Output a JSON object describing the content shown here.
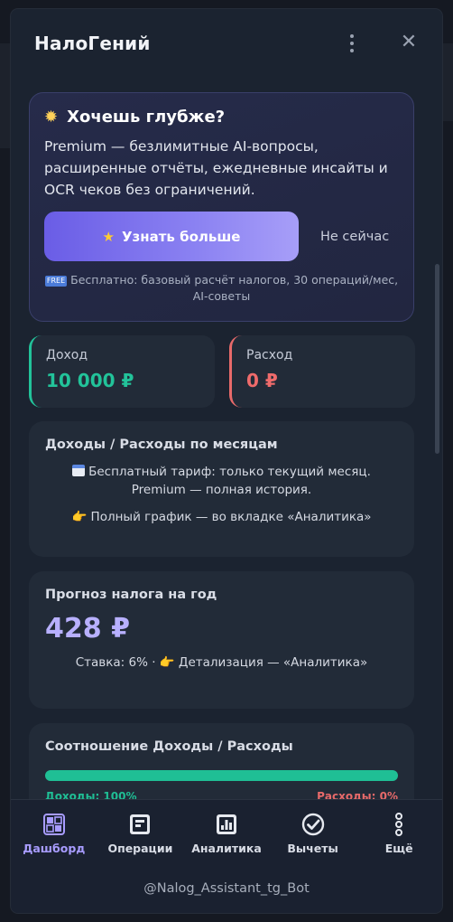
{
  "app": {
    "title": "НалоГений"
  },
  "promo": {
    "title": "Хочешь глубже?",
    "description": "Premium — безлимитные AI-вопросы, расширенные отчёты, ежедневные инсайты и OCR чеков без ограничений.",
    "cta_label": "Узнать больше",
    "later_label": "Не сейчас",
    "free_badge": "FREE",
    "free_note": "Бесплатно: базовый расчёт налогов, 30 операций/мес, AI-советы"
  },
  "stats": {
    "income": {
      "label": "Доход",
      "value": "10 000 ₽"
    },
    "expense": {
      "label": "Расход",
      "value": "0 ₽"
    }
  },
  "monthly": {
    "title": "Доходы / Расходы по месяцам",
    "note1": "Бесплатный тариф: только текущий месяц. Premium — полная история.",
    "note2": "👉 Полный график — во вкладке «Аналитика»"
  },
  "forecast": {
    "title": "Прогноз налога на год",
    "value": "428 ₽",
    "note": "Ставка: 6% · 👉 Детализация — «Аналитика»"
  },
  "ratio": {
    "title": "Соотношение Доходы / Расходы",
    "income_fraction": 1.0,
    "income_label": "Доходы: 100%",
    "expense_label": "Расходы: 0%"
  },
  "nav": {
    "items": [
      {
        "label": "Дашборд",
        "icon": "dashboard-icon",
        "active": true
      },
      {
        "label": "Операции",
        "icon": "operations-icon",
        "active": false
      },
      {
        "label": "Аналитика",
        "icon": "analytics-icon",
        "active": false
      },
      {
        "label": "Вычеты",
        "icon": "check-circle-icon",
        "active": false
      },
      {
        "label": "Ещё",
        "icon": "more-icon",
        "active": false
      }
    ],
    "footer": "@Nalog_Assistant_tg_Bot"
  },
  "colors": {
    "accent": "#8b82f2",
    "income": "#22c39a",
    "expense": "#e86a6a",
    "forecast": "#b8b0ff"
  }
}
